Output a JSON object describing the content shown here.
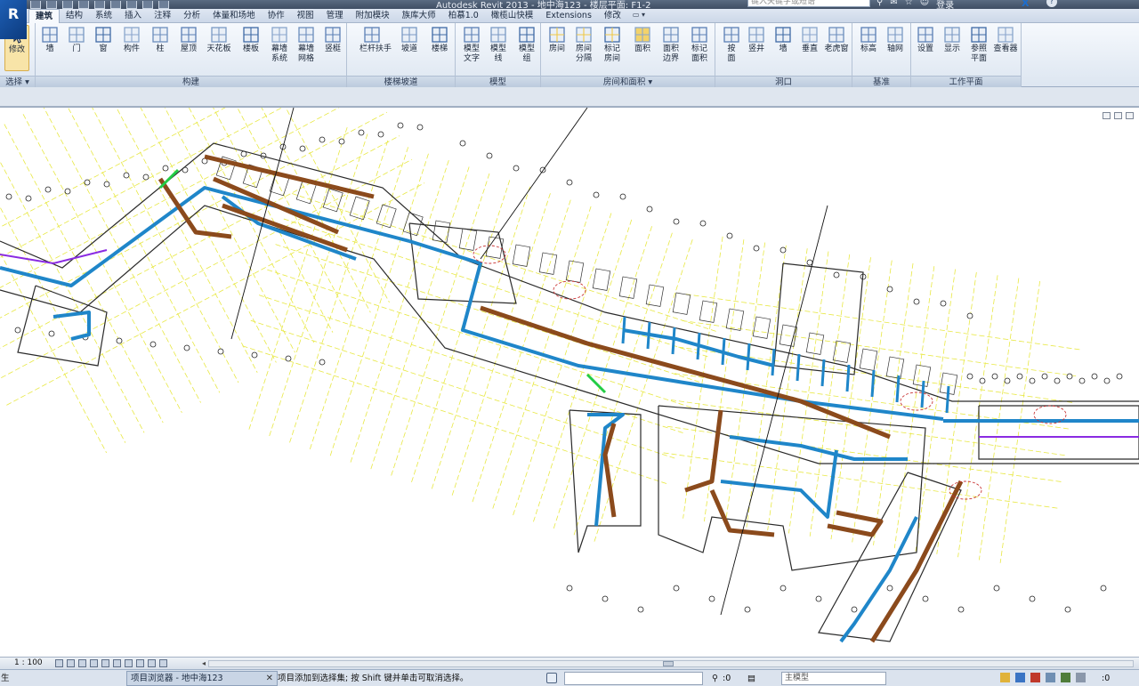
{
  "titlebar": {
    "title": "Autodesk Revit 2013 -    地中海123 - 楼层平面: F1-2",
    "search_placeholder": "键入关键字或短语",
    "sign_in": "登录",
    "exchange_icon": "X",
    "help_icon": "?"
  },
  "tabs": [
    {
      "label": "建筑",
      "active": true
    },
    {
      "label": "结构"
    },
    {
      "label": "系统"
    },
    {
      "label": "插入"
    },
    {
      "label": "注释"
    },
    {
      "label": "分析"
    },
    {
      "label": "体量和场地"
    },
    {
      "label": "协作"
    },
    {
      "label": "视图"
    },
    {
      "label": "管理"
    },
    {
      "label": "附加模块"
    },
    {
      "label": "族库大师"
    },
    {
      "label": "柏慕1.0"
    },
    {
      "label": "橄榄山快模"
    },
    {
      "label": "Extensions"
    },
    {
      "label": "修改"
    }
  ],
  "ribbon": {
    "select": {
      "modify": "修改",
      "title": "选择"
    },
    "build": {
      "title": "构建",
      "tools": [
        "墙",
        "门",
        "窗",
        "构件",
        "柱",
        "屋顶",
        "天花板",
        "楼板",
        "幕墙",
        "幕墙",
        "竖梃"
      ],
      "tools_line2": [
        "",
        "",
        "",
        "",
        "",
        "",
        "",
        "",
        "系统",
        "网格",
        ""
      ]
    },
    "stairs": {
      "title": "楼梯坡道",
      "tools": [
        "栏杆扶手",
        "坡道",
        "楼梯"
      ]
    },
    "model": {
      "title": "模型",
      "tools": [
        "模型",
        "模型",
        "模型"
      ],
      "tools_line2": [
        "文字",
        "线",
        "组"
      ]
    },
    "room": {
      "title": "房间和面积",
      "tools": [
        "房间",
        "房间",
        "标记",
        "面积",
        "面积",
        "标记"
      ],
      "tools_line2": [
        "",
        "分隔",
        "房间",
        "",
        "边界",
        "面积"
      ]
    },
    "opening": {
      "title": "洞口",
      "tools": [
        "按",
        "竖井",
        "墙",
        "垂直",
        "老虎窗"
      ],
      "tools_line2": [
        "面",
        "",
        "",
        "",
        ""
      ]
    },
    "datum": {
      "title": "基准",
      "tools": [
        "标高",
        "轴网"
      ]
    },
    "workplane": {
      "title": "工作平面",
      "tools": [
        "设置",
        "显示",
        "参照",
        "查看器"
      ],
      "tools_line2": [
        "",
        "",
        "平面",
        ""
      ]
    }
  },
  "viewbar": {
    "scale": "1 : 100"
  },
  "statusbar": {
    "left_stub": "生",
    "browser_tab": "项目浏览器 - 地中海123",
    "message": "项目添加到选择集; 按 Shift 键并单击可取消选择。",
    "zero_a": ":0",
    "model_combo": "主模型",
    "zero_b": ":0"
  },
  "colors": {
    "duct_blue": "#1f86c9",
    "pipe_brown": "#8b4a1c",
    "grid_yellow": "#e8e844",
    "wall": "#2a2a2a",
    "purple": "#8a2be2",
    "green": "#22cc44",
    "cloud_red": "#c83232"
  }
}
